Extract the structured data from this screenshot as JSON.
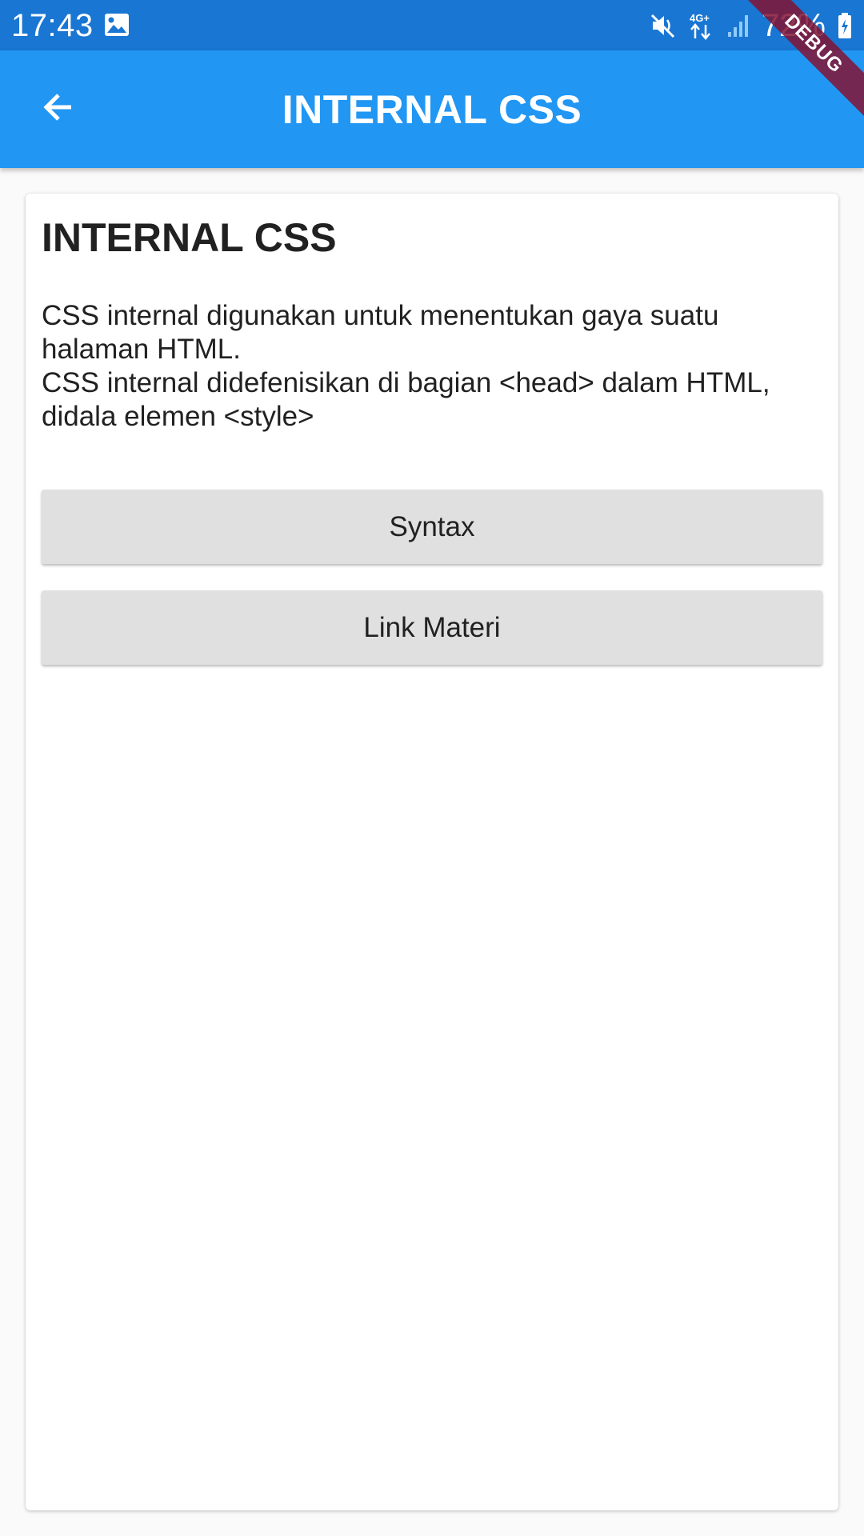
{
  "status_bar": {
    "time": "17:43",
    "battery_percent": "72%",
    "network_type": "4G+",
    "icons": [
      "gallery-icon",
      "mute-icon",
      "data-arrows-icon",
      "signal-icon",
      "battery-charging-icon"
    ]
  },
  "debug_banner": {
    "label": "DEBUG"
  },
  "app_bar": {
    "title": "INTERNAL CSS",
    "back_icon": "arrow-back-icon"
  },
  "content": {
    "title": "INTERNAL CSS",
    "description_line1": "CSS internal digunakan untuk menentukan gaya suatu halaman HTML.",
    "description_line2": "CSS internal didefenisikan di bagian <head> dalam HTML, didala elemen <style>"
  },
  "buttons": {
    "syntax": "Syntax",
    "link_materi": "Link Materi"
  },
  "colors": {
    "status_bar": "#1976d2",
    "app_bar": "#2196f3",
    "button_bg": "#e0e0e0",
    "debug_ribbon": "#821432"
  }
}
